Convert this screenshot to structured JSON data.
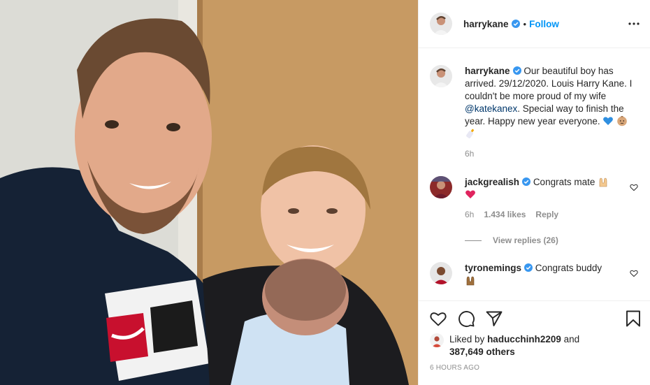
{
  "post": {
    "author": "harrykane",
    "follow_label": "Follow",
    "dot": "•",
    "caption": {
      "text_before_mention": "Our beautiful boy has arrived. 29/12/2020. Louis Harry Kane. I couldn't be more proud of my wife",
      "mention": "@katekanex",
      "text_after_mention": ". Special way to finish the year. Happy new year everyone.",
      "time": "6h"
    },
    "comments": [
      {
        "username": "jackgrealish",
        "text": "Congrats mate",
        "time": "6h",
        "likes": "1.434 likes",
        "reply_label": "Reply",
        "view_replies": "View replies (26)"
      },
      {
        "username": "tyronemings",
        "text": "Congrats buddy"
      }
    ],
    "liked_by": {
      "prefix": "Liked by",
      "user": "haducchinh2209",
      "and": "and",
      "others": "387,649 others"
    },
    "timestamp": "6 HOURS AGO"
  },
  "icons": {
    "verified": "verified-badge-icon",
    "more": "more-options-icon",
    "like": "heart-icon",
    "comment": "comment-icon",
    "share": "share-icon",
    "save": "bookmark-icon"
  },
  "colors": {
    "accent": "#0095f6",
    "text": "#262626",
    "muted": "#8e8e8e",
    "mention": "#00376b",
    "heart_red": "#ed4956"
  }
}
